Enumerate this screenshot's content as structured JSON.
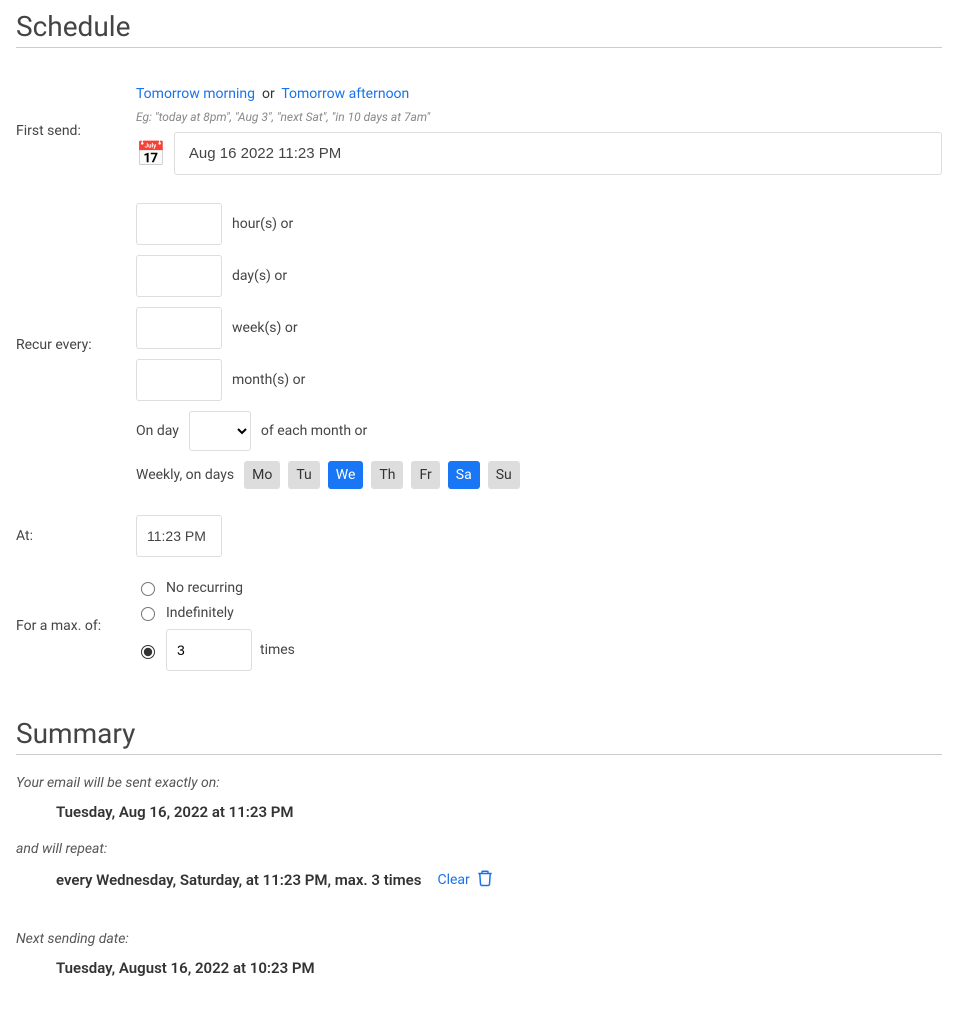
{
  "schedule": {
    "title": "Schedule",
    "first_send_label": "First send:",
    "tomorrow_morning": "Tomorrow morning",
    "or": "or",
    "tomorrow_afternoon": "Tomorrow afternoon",
    "hint": "Eg: \"today at 8pm\", \"Aug 3\", \"next Sat\", \"in 10 days at 7am\"",
    "date_value": "Aug 16 2022 11:23 PM",
    "recur_label": "Recur every:",
    "hours_label": "hour(s) or",
    "days_label": "day(s) or",
    "weeks_label": "week(s) or",
    "months_label": "month(s) or",
    "on_day_prefix": "On day",
    "on_day_suffix": "of each month or",
    "weekly_label": "Weekly, on days",
    "day_chips": [
      {
        "label": "Mo",
        "active": false
      },
      {
        "label": "Tu",
        "active": false
      },
      {
        "label": "We",
        "active": true
      },
      {
        "label": "Th",
        "active": false
      },
      {
        "label": "Fr",
        "active": false
      },
      {
        "label": "Sa",
        "active": true
      },
      {
        "label": "Su",
        "active": false
      }
    ],
    "at_label": "At:",
    "at_value": "11:23 PM",
    "max_label": "For a max. of:",
    "no_recurring": "No recurring",
    "indefinitely": "Indefinitely",
    "times_value": "3",
    "times_label": "times",
    "selected_max_option": "times"
  },
  "summary": {
    "title": "Summary",
    "sent_exactly": "Your email will be sent exactly on:",
    "sent_date": "Tuesday, Aug 16, 2022 at 11:23 PM",
    "and_repeat": "and will repeat:",
    "repeat_text": "every Wednesday, Saturday, at 11:23 PM, max. 3 times",
    "clear": "Clear",
    "next_sending": "Next sending date:",
    "next_date": "Tuesday, August 16, 2022 at 10:23 PM"
  }
}
